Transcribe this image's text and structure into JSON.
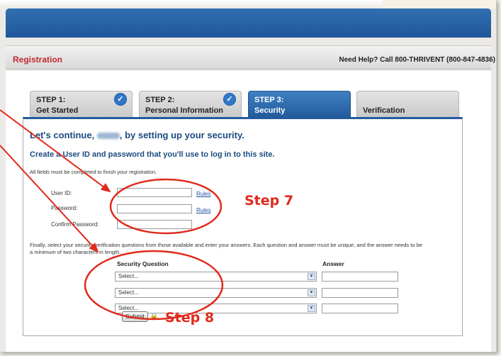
{
  "header": {
    "section_title": "Registration",
    "help_text": "Need Help? Call 800-THRIVENT (800-847-4836)"
  },
  "steps": [
    {
      "label": "STEP 1:",
      "name": "Get Started",
      "completed": true
    },
    {
      "label": "STEP 2:",
      "name": "Personal Information",
      "completed": true
    },
    {
      "label": "STEP 3:",
      "name": "Security",
      "active": true
    },
    {
      "label": "",
      "name": "Verification"
    }
  ],
  "form": {
    "heading_before": "Let's continue,",
    "heading_after": ", by setting up your security.",
    "subheading": "Create a User ID and password that you'll use to log in to this site.",
    "required_note": "All fields must be completed to finish your registration.",
    "user_id_label": "User ID:",
    "password_label": "Password:",
    "confirm_label": "Confirm Password:",
    "rules_link": "Rules",
    "security_instructions": "Finally, select your security verification questions from those available and enter your answers. Each question and answer must be unique, and the answer needs to be a minimum of two characters in length.",
    "security_question_header": "Security Question",
    "answer_header": "Answer",
    "select_placeholder": "Select...",
    "submit_label": "Submit"
  },
  "annotations": {
    "step7": "Step 7",
    "step8": "Step 8"
  },
  "colors": {
    "brand_blue": "#235c9e",
    "registration_red": "#c0282d",
    "annotation_red": "#e02a1c"
  }
}
